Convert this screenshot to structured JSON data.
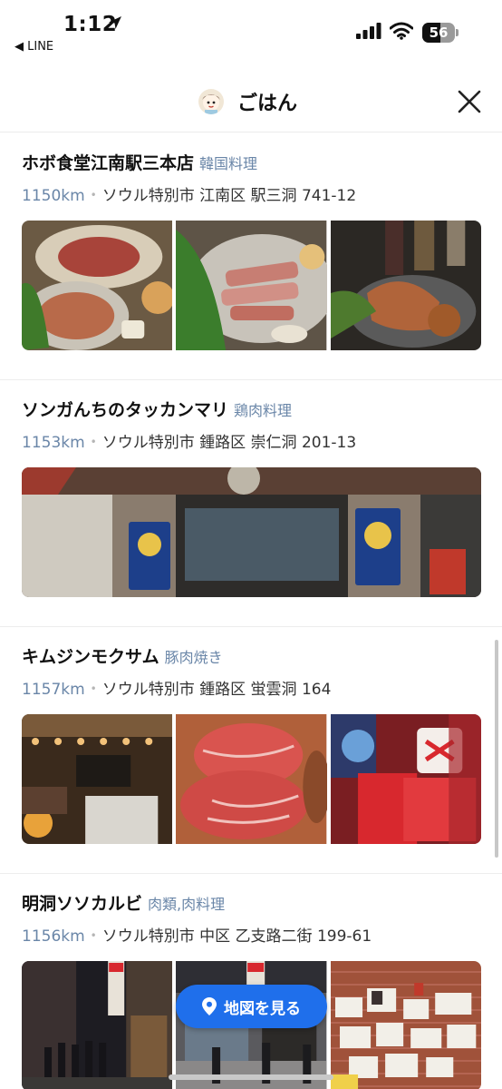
{
  "status_bar": {
    "time": "1:12",
    "back_app": "◀ LINE",
    "battery_level": 56,
    "battery_text": "56",
    "location_icon": "location-arrow-icon",
    "signal_icon": "cellular-signal-icon",
    "wifi_icon": "wifi-icon"
  },
  "header": {
    "title": "ごはん",
    "avatar_icon": "character-avatar",
    "close_icon": "close-icon"
  },
  "restaurants": [
    {
      "name": "ホボ食堂江南駅三本店",
      "category": "韓国料理",
      "distance": "1150km",
      "address": "ソウル特別市 江南区 駅三洞 741-12",
      "photos": [
        "grilled-meat-platter",
        "pork-belly-with-greens",
        "grilled-meat-with-wine"
      ]
    },
    {
      "name": "ソンガんちのタッカンマリ",
      "category": "鶏肉料理",
      "distance": "1153km",
      "address": "ソウル特別市 鍾路区 崇仁洞 201-13",
      "photos": [
        "restaurant-storefront"
      ]
    },
    {
      "name": "キムジンモクサム",
      "category": "豚肉焼き",
      "distance": "1157km",
      "address": "ソウル特別市 鍾路区 蛍雲洞 164",
      "photos": [
        "restaurant-entrance",
        "raw-pork-neck",
        "award-plaques"
      ]
    },
    {
      "name": "明洞ソソカルビ",
      "category": "肉類,肉料理",
      "distance": "1156km",
      "address": "ソウル特別市 中区 乙支路二街 199-61",
      "photos": [
        "night-street-queue",
        "street-shop-front",
        "signed-papers-wall"
      ]
    }
  ],
  "map_button": {
    "label": "地図を見る",
    "icon": "map-pin-icon"
  },
  "colors": {
    "accent": "#1f6feb",
    "meta_blue": "#6a86a8",
    "divider": "#ededed"
  }
}
